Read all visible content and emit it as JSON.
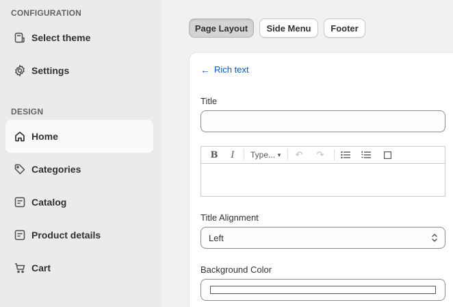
{
  "sidebar": {
    "configuration_title": "CONFIGURATION",
    "configuration_items": [
      {
        "label": "Select theme",
        "icon": "theme-icon"
      },
      {
        "label": "Settings",
        "icon": "gear-icon"
      }
    ],
    "design_title": "DESIGN",
    "design_items": [
      {
        "label": "Home",
        "icon": "home-icon",
        "active": true
      },
      {
        "label": "Categories",
        "icon": "tag-icon"
      },
      {
        "label": "Catalog",
        "icon": "catalog-icon"
      },
      {
        "label": "Product details",
        "icon": "catalog-icon"
      },
      {
        "label": "Cart",
        "icon": "cart-icon"
      }
    ]
  },
  "tabs": [
    {
      "label": "Page Layout",
      "active": true
    },
    {
      "label": "Side Menu",
      "active": false
    },
    {
      "label": "Footer",
      "active": false
    }
  ],
  "panel": {
    "back_label": "Rich text",
    "title_label": "Title",
    "title_value": "",
    "toolbar": {
      "bold": "B",
      "italic": "I",
      "type_dropdown": "Type...",
      "undo": "↶",
      "redo": "↷"
    },
    "alignment_label": "Title Alignment",
    "alignment_value": "Left",
    "background_label": "Background Color",
    "background_value": "#ffffff"
  },
  "colors": {
    "accent": "#005bd3",
    "sidebar_bg": "#ebebeb",
    "page_bg": "#f1f1f1"
  }
}
